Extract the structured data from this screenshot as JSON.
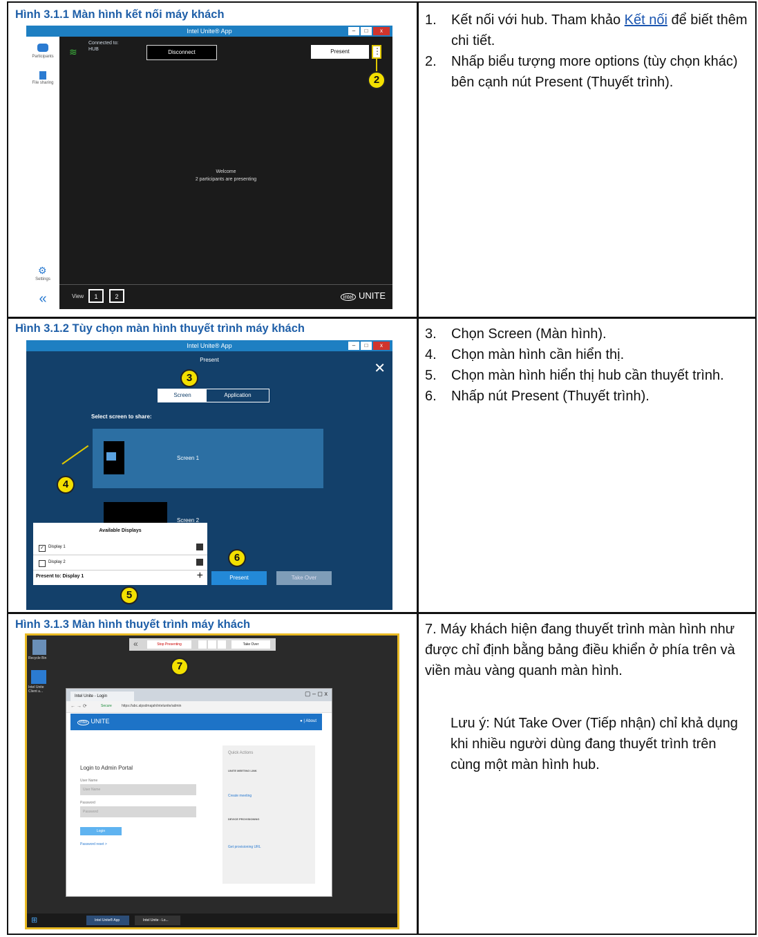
{
  "sections": [
    {
      "caption": "Hình 3.1.1 Màn hình kết nối máy khách",
      "steps": [
        {
          "num": "1.",
          "text_before": "Kết nối với hub. Tham khảo ",
          "link": "Kết nối",
          "text_after": " để biết thêm chi tiết."
        },
        {
          "num": "2.",
          "text": "Nhấp biểu tượng more options (tùy chọn khác) bên cạnh nút Present (Thuyết trình)."
        }
      ],
      "screenshot": {
        "title": "Intel Unite® App",
        "connected_label": "Connected to:",
        "hub_name": "HUB",
        "disconnect": "Disconnect",
        "present": "Present",
        "participants": "Participants",
        "file_sharing": "File sharing",
        "settings": "Settings",
        "welcome": "Welcome",
        "status": "2 participants are presenting",
        "view_label": "View",
        "view1": "1",
        "view2": "2",
        "brand": "UNITE",
        "callout": "2"
      }
    },
    {
      "caption": "Hình 3.1.2 Tùy chọn màn hình thuyết trình máy khách",
      "steps": [
        {
          "num": "3.",
          "text": "Chọn Screen (Màn hình)."
        },
        {
          "num": "4.",
          "text": "Chọn màn hình cần hiển thị."
        },
        {
          "num": "5.",
          "text": "Chọn màn hình hiển thị hub cần thuyết trình."
        },
        {
          "num": "6.",
          "text": "Nhấp nút Present (Thuyết trình)."
        }
      ],
      "screenshot": {
        "title": "Intel Unite® App",
        "header": "Present",
        "tab_screen": "Screen",
        "tab_application": "Application",
        "select_label": "Select screen to share:",
        "screen1": "Screen 1",
        "screen2": "Screen 2",
        "available_displays": "Available Displays",
        "display1": "Display 1",
        "display2": "Display 2",
        "present_to": "Present to: Display 1",
        "present_btn": "Present",
        "take_over_btn": "Take Over",
        "callout3": "3",
        "callout4": "4",
        "callout5": "5",
        "callout6": "6"
      }
    },
    {
      "caption": "Hình 3.1.3 Màn hình thuyết trình máy khách",
      "step_num": "7.",
      "step_text": "Máy khách hiện đang thuyết trình màn hình như được chỉ định bằng bảng điều khiển ở phía trên và viền màu vàng quanh màn hình.",
      "note": "Lưu ý: Nút Take Over (Tiếp nhận) chỉ khả dụng khi nhiều người dùng đang thuyết trình trên cùng một màn hình hub.",
      "screenshot": {
        "stop_presenting": "Stop Presenting",
        "take_over": "Take Over",
        "recycle_bin": "Recycle Bin",
        "desktop_icon": "Intel Unite Client a...",
        "browser_tab": "Intel Unite - Login",
        "url": "https://abc.alpsdmajah/intelunite/admin",
        "secure": "Secure",
        "brand": "UNITE",
        "about": "About",
        "login_title": "Login to Admin Portal",
        "user_label": "User Name",
        "user_placeholder": "User Name",
        "pass_label": "Password",
        "pass_placeholder": "Password",
        "login_btn": "Login",
        "reset": "Password reset >",
        "quick_actions": "Quick Actions",
        "meeting_link_title": "UNITE MEETING LINK",
        "create_meeting": "Create meeting",
        "provisioning_title": "DEVICE PROVISIONING",
        "get_link": "Get provisioning URL",
        "taskbar_app1": "Intel Unite® App",
        "taskbar_app2": "Intel Unite - Lo...",
        "callout7": "7"
      }
    }
  ],
  "colors": {
    "caption": "#1f5fa8",
    "titlebar": "#1e7fc2",
    "present_blue": "#13406a",
    "yellow_border": "#e8b923"
  }
}
